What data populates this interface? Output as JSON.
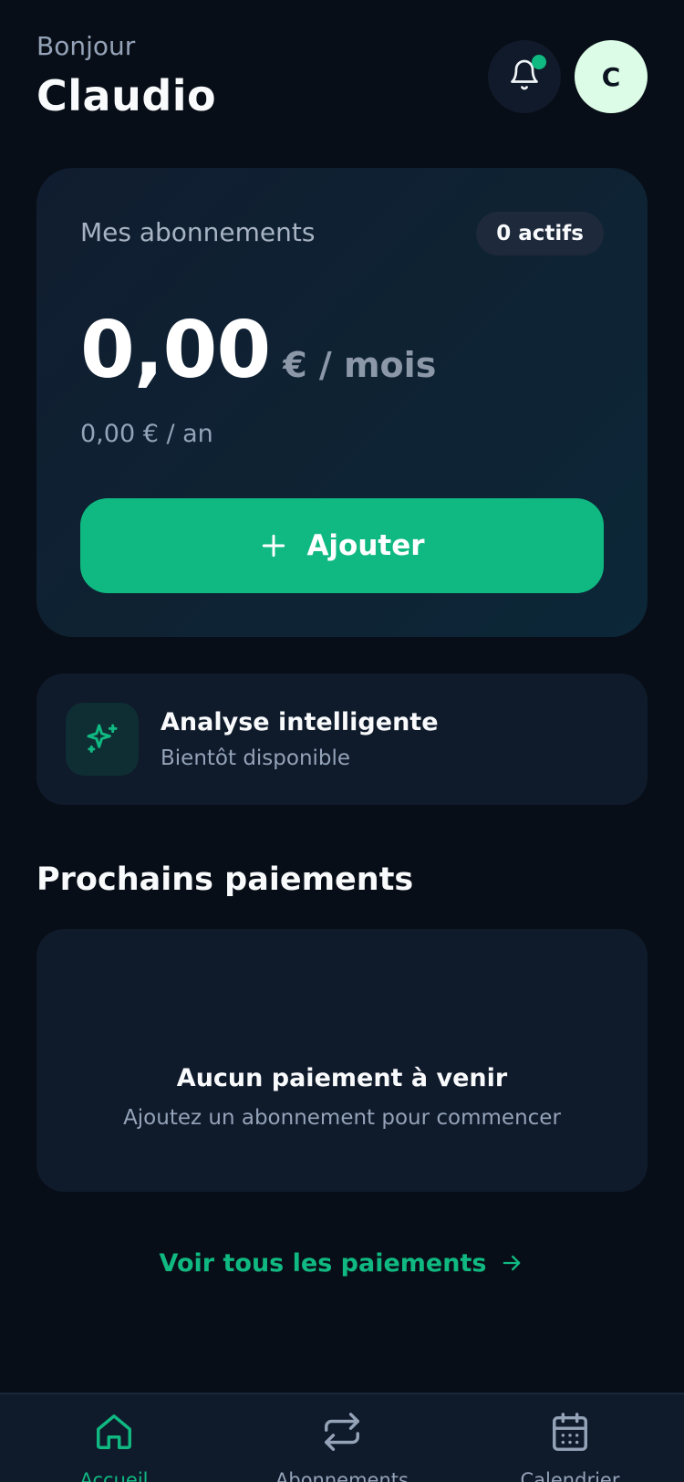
{
  "header": {
    "greeting": "Bonjour",
    "user_name": "Claudio",
    "avatar_initial": "C",
    "notification_dot": true
  },
  "subscriptions_card": {
    "title": "Mes abonnements",
    "badge": "0 actifs",
    "amount": "0,00",
    "amount_unit": "€ / mois",
    "yearly": "0,00 € / an",
    "add_button_label": "Ajouter"
  },
  "ai_card": {
    "icon": "sparkles-icon",
    "title": "Analyse intelligente",
    "subtitle": "Bientôt disponible"
  },
  "upcoming_payments": {
    "title": "Prochains paiements",
    "empty_title": "Aucun paiement à venir",
    "empty_subtitle": "Ajoutez un abonnement pour commencer",
    "see_all_label": "Voir tous les paiements"
  },
  "bottom_nav": {
    "items": [
      {
        "label": "Accueil",
        "icon": "home-icon",
        "active": true
      },
      {
        "label": "Abonnements",
        "icon": "repeat-icon",
        "active": false
      },
      {
        "label": "Calendrier",
        "icon": "calendar-icon",
        "active": false
      }
    ]
  },
  "colors": {
    "background": "#080e17",
    "card": "#0f1a2b",
    "accent": "#10b981",
    "text_primary": "#f8fafc",
    "text_muted": "#94a3b8"
  }
}
